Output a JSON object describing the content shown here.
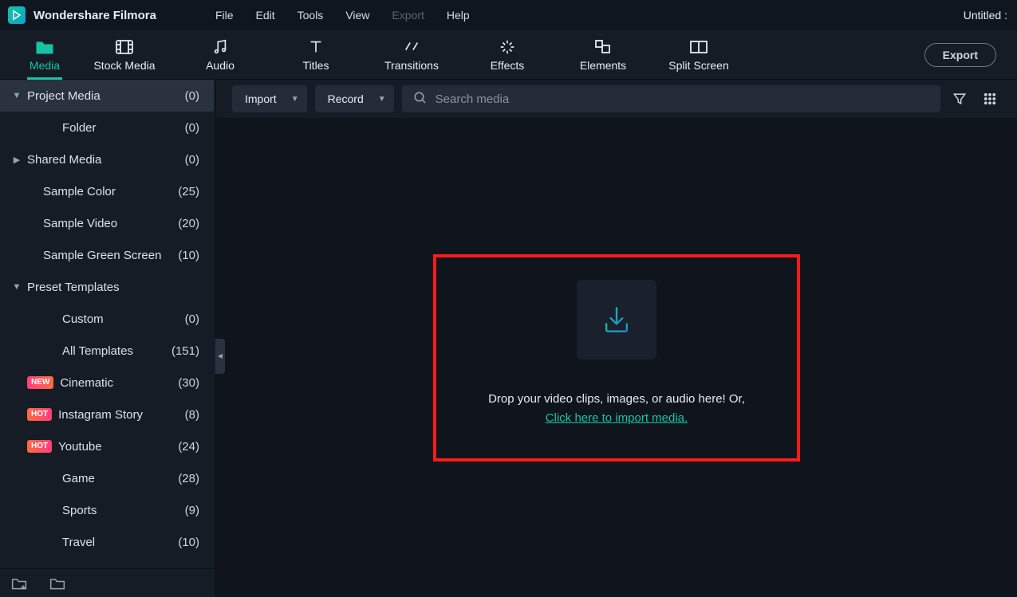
{
  "app": {
    "title": "Wondershare Filmora",
    "project": "Untitled :"
  },
  "menu": {
    "file": "File",
    "edit": "Edit",
    "tools": "Tools",
    "view": "View",
    "export": "Export",
    "help": "Help"
  },
  "toolTabs": {
    "media": "Media",
    "stock": "Stock Media",
    "audio": "Audio",
    "titles": "Titles",
    "transitions": "Transitions",
    "effects": "Effects",
    "elements": "Elements",
    "split": "Split Screen"
  },
  "exportBtn": "Export",
  "contentBar": {
    "import": "Import",
    "record": "Record",
    "searchPlaceholder": "Search media"
  },
  "dropZone": {
    "line1": "Drop your video clips, images, or audio here! Or,",
    "link": "Click here to import media."
  },
  "tree": {
    "projectMedia": {
      "label": "Project Media",
      "count": "(0)"
    },
    "folder": {
      "label": "Folder",
      "count": "(0)"
    },
    "sharedMedia": {
      "label": "Shared Media",
      "count": "(0)"
    },
    "sampleColor": {
      "label": "Sample Color",
      "count": "(25)"
    },
    "sampleVideo": {
      "label": "Sample Video",
      "count": "(20)"
    },
    "sampleGreen": {
      "label": "Sample Green Screen",
      "count": "(10)"
    },
    "preset": {
      "label": "Preset Templates"
    },
    "custom": {
      "label": "Custom",
      "count": "(0)"
    },
    "allTemplates": {
      "label": "All Templates",
      "count": "(151)"
    },
    "cinematic": {
      "label": "Cinematic",
      "count": "(30)",
      "badge": "NEW"
    },
    "instagram": {
      "label": "Instagram Story",
      "count": "(8)",
      "badge": "HOT"
    },
    "youtube": {
      "label": "Youtube",
      "count": "(24)",
      "badge": "HOT"
    },
    "game": {
      "label": "Game",
      "count": "(28)"
    },
    "sports": {
      "label": "Sports",
      "count": "(9)"
    },
    "travel": {
      "label": "Travel",
      "count": "(10)"
    }
  }
}
